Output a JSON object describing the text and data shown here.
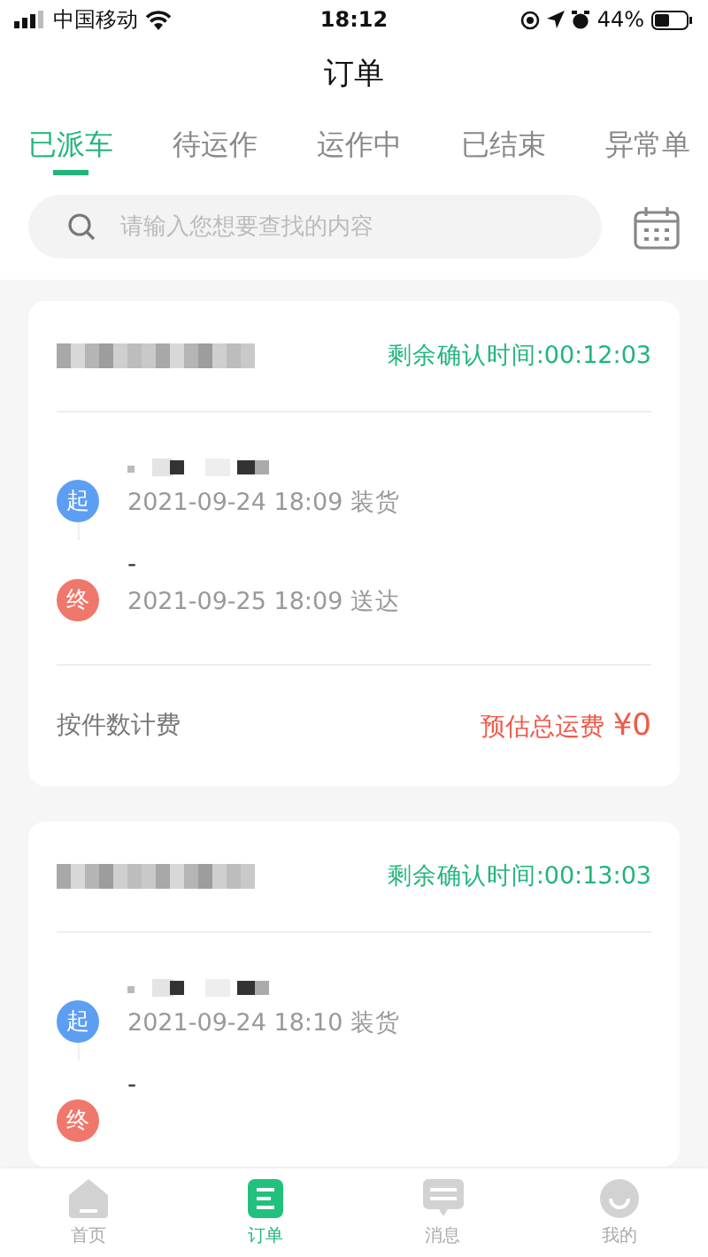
{
  "status_bar": {
    "carrier": "中国移动",
    "time": "18:12",
    "battery": "44%"
  },
  "title": "订单",
  "tabs": [
    {
      "label": "已派车",
      "selected": true
    },
    {
      "label": "待运作",
      "selected": false
    },
    {
      "label": "运作中",
      "selected": false
    },
    {
      "label": "已结束",
      "selected": false
    },
    {
      "label": "异常单",
      "selected": false
    }
  ],
  "search": {
    "placeholder": "请输入您想要查找的内容"
  },
  "orders": [
    {
      "countdown": "剩余确认时间:00:12:03",
      "stops": [
        {
          "kind": "start",
          "badge": "起",
          "time": "2021-09-24 18:09 装货"
        },
        {
          "kind": "end",
          "badge": "终",
          "address": "-",
          "time": "2021-09-25 18:09 送达"
        }
      ],
      "pricing": "按件数计费",
      "fee_label": "预估总运费",
      "fee_value": "¥0"
    },
    {
      "countdown": "剩余确认时间:00:13:03",
      "stops": [
        {
          "kind": "start",
          "badge": "起",
          "time": "2021-09-24 18:10 装货"
        },
        {
          "kind": "end",
          "badge": "终",
          "address": "-"
        }
      ]
    }
  ],
  "nav": [
    {
      "label": "首页",
      "selected": false
    },
    {
      "label": "订单",
      "selected": true
    },
    {
      "label": "消息",
      "selected": false
    },
    {
      "label": "我的",
      "selected": false
    }
  ]
}
